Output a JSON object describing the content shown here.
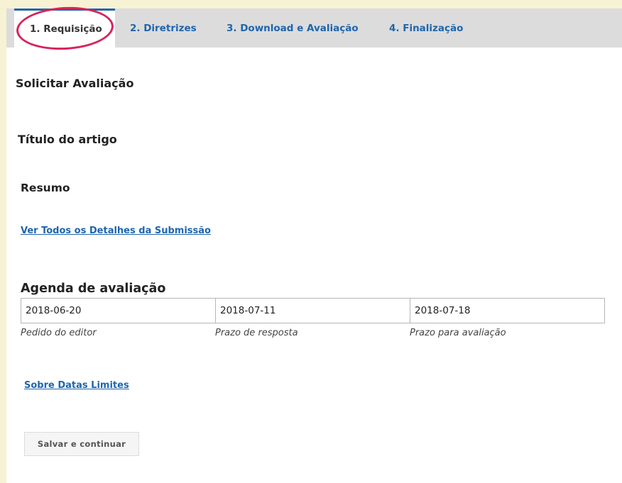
{
  "tabs": [
    {
      "label": "1. Requisição",
      "active": true
    },
    {
      "label": "2. Diretrizes",
      "active": false
    },
    {
      "label": "3. Download e Avaliação",
      "active": false
    },
    {
      "label": "4. Finalização",
      "active": false
    }
  ],
  "content": {
    "section_title": "Solicitar Avaliação",
    "article_title": "Título do artigo",
    "abstract_title": "Resumo",
    "details_link": "Ver Todos os Detalhes da Submissão",
    "schedule_title": "Agenda de avaliação",
    "dates": [
      {
        "value": "2018-06-20",
        "label": "Pedido do editor"
      },
      {
        "value": "2018-07-11",
        "label": "Prazo de resposta"
      },
      {
        "value": "2018-07-18",
        "label": "Prazo para avaliação"
      }
    ],
    "deadlines_link": "Sobre Datas Limites",
    "save_button": "Salvar e continuar"
  },
  "colors": {
    "page_background": "#f8f2d4",
    "link": "#1f65ad",
    "highlight_circle": "#d8235b",
    "tab_bar": "#dcdcdc"
  }
}
